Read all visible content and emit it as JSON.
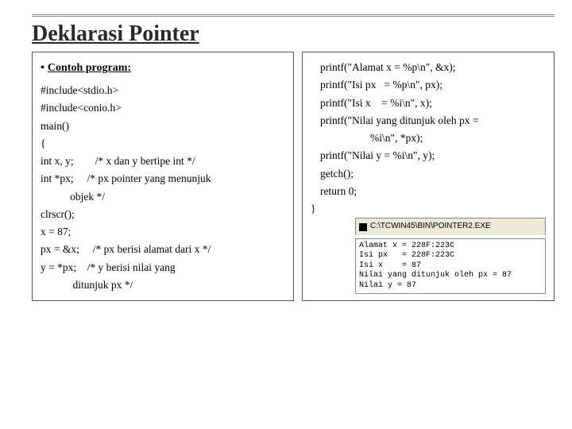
{
  "title": "Deklarasi Pointer",
  "left": {
    "heading": "Contoh program:",
    "lines": [
      "#include<stdio.h>",
      "#include<conio.h>",
      "main()",
      "{",
      "int x, y;        /* x dan y bertipe int */",
      "int *px;     /* px pointer yang menunjuk",
      "           objek */",
      "clrscr();",
      "x = 87;",
      "px = &x;     /* px berisi alamat dari x */",
      "y = *px;    /* y berisi nilai yang",
      "            ditunjuk px */"
    ]
  },
  "right": {
    "lines": [
      "printf(\"Alamat x = %p\\n\", &x);",
      "printf(\"Isi px   = %p\\n\", px);",
      "printf(\"Isi x    = %i\\n\", x);",
      "printf(\"Nilai yang ditunjuk oleh px =",
      "        %i\\n\", *px);",
      "printf(\"Nilai y = %i\\n\", y);",
      "getch();",
      "return 0;",
      "}"
    ]
  },
  "console": {
    "title_path": "C:\\TCWIN45\\BIN\\POINTER2.EXE",
    "output": "Alamat x = 228F:223C\nIsi px   = 228F:223C\nIsi x    = 87\nNilai yang ditunjuk oleh px = 87\nNilai y = 87"
  }
}
